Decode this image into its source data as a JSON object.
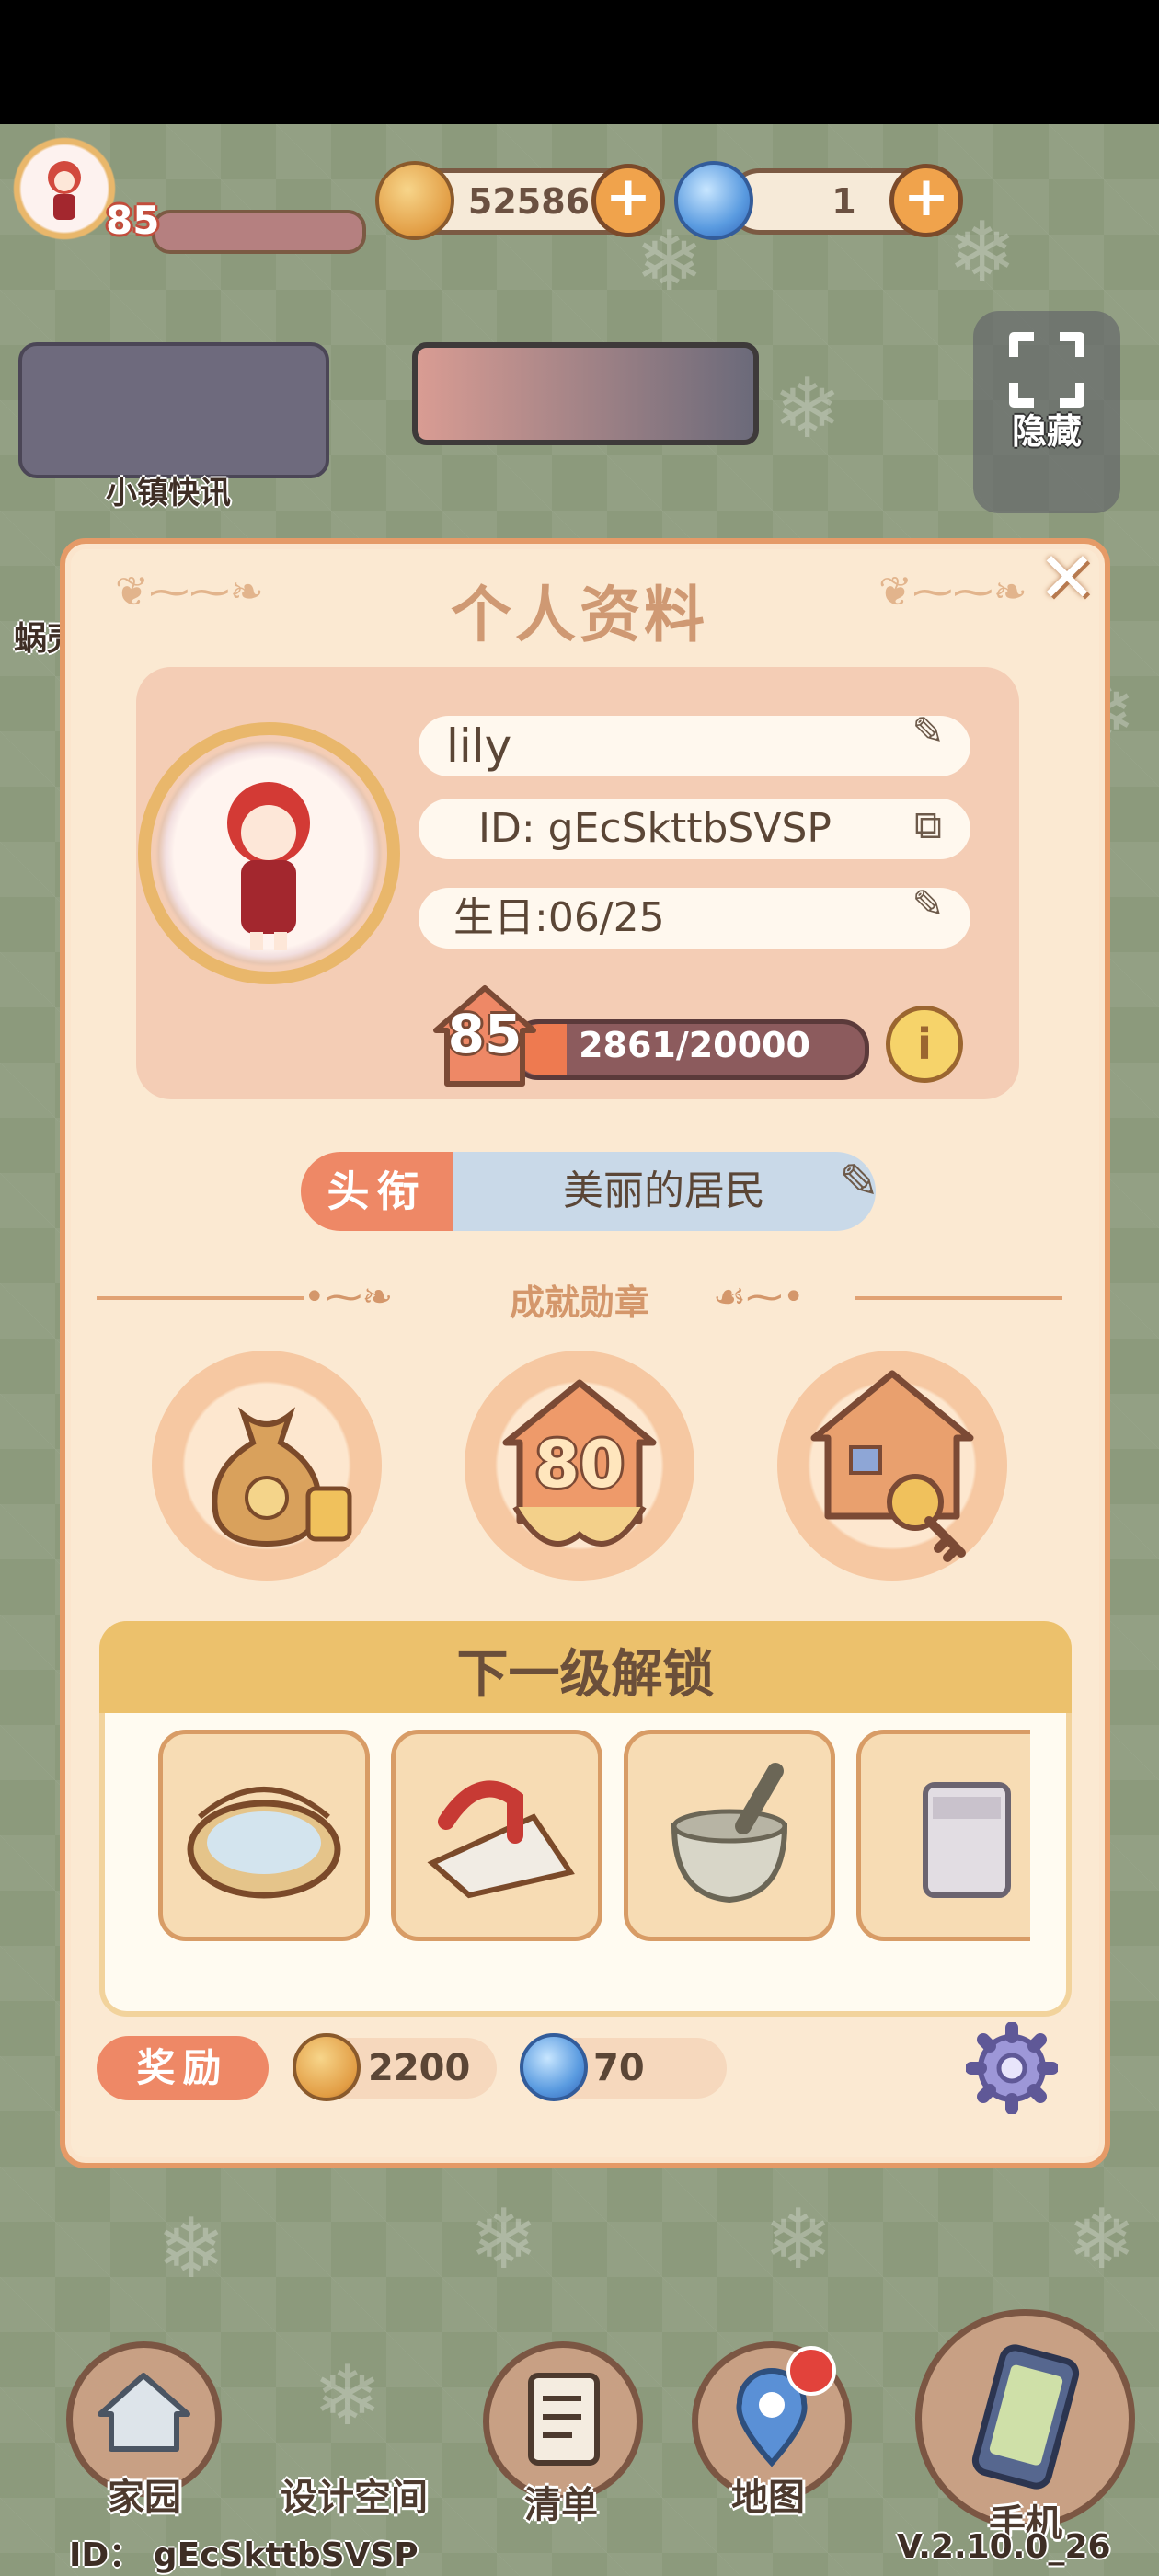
{
  "hud": {
    "player_level": "85",
    "coins": "52586",
    "gems": "1",
    "hide_label": "隐藏",
    "town_news_label": "小镇快讯",
    "side_label": "蜗壳"
  },
  "dialog": {
    "title": "个人资料",
    "name": "lily",
    "id": "ID: gEcSkttbSVSP",
    "birthday": "生日:06/25",
    "level": "85",
    "xp": "2861/20000",
    "xp_fraction": 0.143,
    "title_label": "头衔",
    "title_value": "美丽的居民",
    "achievements_label": "成就勋章",
    "medals": [
      {
        "icon": "money-bag-icon"
      },
      {
        "icon": "level-80-icon",
        "text": "80"
      },
      {
        "icon": "house-key-icon"
      }
    ],
    "next_unlock_label": "下一级解锁",
    "unlock_items": [
      {
        "icon": "sieve-basket-icon"
      },
      {
        "icon": "iron-icon"
      },
      {
        "icon": "mortar-pestle-icon"
      },
      {
        "icon": "washing-machine-icon"
      }
    ],
    "reward_label": "奖励",
    "reward_coins": "2200",
    "reward_gems": "70"
  },
  "nav": {
    "home": "家园",
    "design": "设计空间",
    "list": "清单",
    "map": "地图",
    "phone": "手机"
  },
  "footer": {
    "id": "ID： gEcSkttbSVSP",
    "version": "V.2.10.0_26"
  },
  "colors": {
    "dialog_bg": "#fbe9d2",
    "accent": "#ee8866",
    "title_color": "#cf9973"
  }
}
